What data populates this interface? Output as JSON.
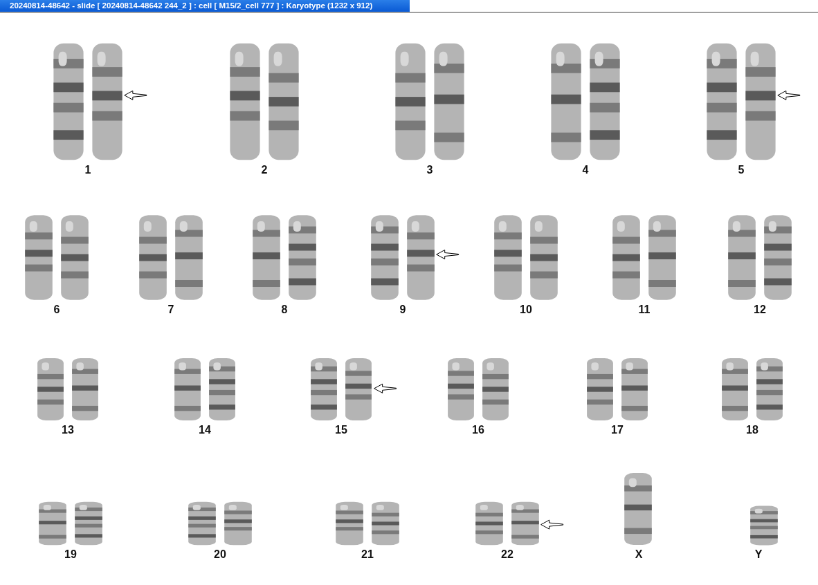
{
  "window": {
    "title": "20240814-48642 - slide [ 20240814-48642 244_2 ] : cell [ M15/2_cell 777 ] : Karyotype  (1232 x 912)"
  },
  "rows": [
    {
      "groups": [
        {
          "label": "1",
          "homologs": [
            {
              "arrow": false
            },
            {
              "arrow": true
            }
          ]
        },
        {
          "label": "2",
          "homologs": [
            {
              "arrow": false
            },
            {
              "arrow": false
            }
          ]
        },
        {
          "label": "3",
          "homologs": [
            {
              "arrow": false
            },
            {
              "arrow": false
            }
          ]
        },
        {
          "label": "4",
          "homologs": [
            {
              "arrow": false
            },
            {
              "arrow": false
            }
          ]
        },
        {
          "label": "5",
          "homologs": [
            {
              "arrow": false
            },
            {
              "arrow": true
            }
          ]
        }
      ]
    },
    {
      "groups": [
        {
          "label": "6",
          "homologs": [
            {
              "arrow": false
            },
            {
              "arrow": false
            }
          ]
        },
        {
          "label": "7",
          "homologs": [
            {
              "arrow": false
            },
            {
              "arrow": false
            }
          ]
        },
        {
          "label": "8",
          "homologs": [
            {
              "arrow": false
            },
            {
              "arrow": false
            }
          ]
        },
        {
          "label": "9",
          "homologs": [
            {
              "arrow": false
            },
            {
              "arrow": true
            }
          ]
        },
        {
          "label": "10",
          "homologs": [
            {
              "arrow": false
            },
            {
              "arrow": false
            }
          ]
        },
        {
          "label": "11",
          "homologs": [
            {
              "arrow": false
            },
            {
              "arrow": false
            }
          ]
        },
        {
          "label": "12",
          "homologs": [
            {
              "arrow": false
            },
            {
              "arrow": false
            }
          ]
        }
      ]
    },
    {
      "groups": [
        {
          "label": "13",
          "homologs": [
            {
              "arrow": false
            },
            {
              "arrow": false
            }
          ]
        },
        {
          "label": "14",
          "homologs": [
            {
              "arrow": false
            },
            {
              "arrow": false
            }
          ]
        },
        {
          "label": "15",
          "homologs": [
            {
              "arrow": false
            },
            {
              "arrow": true
            }
          ]
        },
        {
          "label": "16",
          "homologs": [
            {
              "arrow": false
            },
            {
              "arrow": false
            }
          ]
        },
        {
          "label": "17",
          "homologs": [
            {
              "arrow": false
            },
            {
              "arrow": false
            }
          ]
        },
        {
          "label": "18",
          "homologs": [
            {
              "arrow": false
            },
            {
              "arrow": false
            }
          ]
        }
      ]
    },
    {
      "groups": [
        {
          "label": "19",
          "homologs": [
            {
              "arrow": false
            },
            {
              "arrow": false
            }
          ]
        },
        {
          "label": "20",
          "homologs": [
            {
              "arrow": false
            },
            {
              "arrow": false
            }
          ]
        },
        {
          "label": "21",
          "homologs": [
            {
              "arrow": false
            },
            {
              "arrow": false
            }
          ]
        },
        {
          "label": "22",
          "homologs": [
            {
              "arrow": false
            },
            {
              "arrow": true
            }
          ]
        },
        {
          "label": "X",
          "homologs": [
            {
              "arrow": false
            }
          ]
        },
        {
          "label": "Y",
          "homologs": [
            {
              "arrow": false
            }
          ]
        }
      ]
    }
  ]
}
